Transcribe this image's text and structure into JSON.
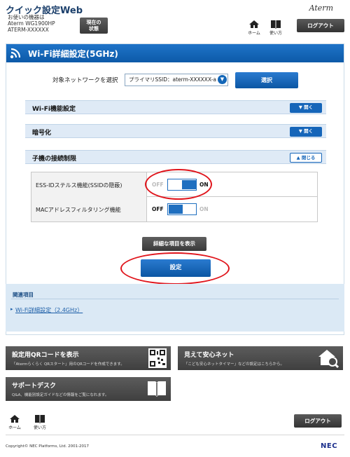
{
  "header": {
    "app_title": "クイック設定Web",
    "model_label": "お使いの機器は",
    "model_name": "Aterm WG1900HP",
    "ssid_id": "ATERM-XXXXXX",
    "status_button": [
      "現在の",
      "状態"
    ],
    "brand": "Aterm",
    "nav_home": "ホーム",
    "nav_help": "使い方",
    "logout": "ログアウト"
  },
  "page": {
    "title": "Wi-Fi詳細設定(5GHz)",
    "target_label": "対象ネットワークを選択",
    "network_select_value": "プライマリSSID：aterm-XXXXXX-a",
    "select_button": "選択"
  },
  "sections": [
    {
      "label": "Wi-Fi機能設定",
      "button": "開く",
      "state": "collapsed"
    },
    {
      "label": "暗号化",
      "button": "開く",
      "state": "collapsed"
    },
    {
      "label": "子機の接続制限",
      "button": "閉じる",
      "state": "expanded"
    }
  ],
  "settings": [
    {
      "label": "ESS-IDステルス機能(SSIDの隠蔽)",
      "off_label": "OFF",
      "on_label": "ON",
      "value": "ON"
    },
    {
      "label": "MACアドレスフィルタリング機能",
      "off_label": "OFF",
      "on_label": "ON",
      "value": "OFF"
    }
  ],
  "buttons": {
    "show_details": "詳細な項目を表示",
    "apply": "設定"
  },
  "related": {
    "title": "関連項目",
    "link": "Wi-Fi詳細設定（2.4GHz）"
  },
  "tiles": [
    {
      "title": "設定用QRコードを表示",
      "desc": "「Atermらくらく QRスタート」用のQRコードを作成できます。",
      "icon": "qr-code-icon"
    },
    {
      "title": "見えて安心ネット",
      "desc": "「こども安心ネットタイマー」などの設定はこちらから。",
      "icon": "home-search-icon"
    },
    {
      "title": "サポートデスク",
      "desc": "Q&A、機能別設定ガイドなどの情報をご覧になれます。",
      "icon": "book-icon"
    }
  ],
  "footer": {
    "nav_home": "ホーム",
    "nav_help": "使い方",
    "logout": "ログアウト",
    "copyright": "Copyright© NEC Platforms, Ltd. 2001-2017",
    "logo": "NEC"
  },
  "colors": {
    "accent_blue": "#1266b8",
    "highlight_red": "#e0141b",
    "section_bg": "#dfeaf6",
    "dark_button": "#3a3a3a"
  }
}
